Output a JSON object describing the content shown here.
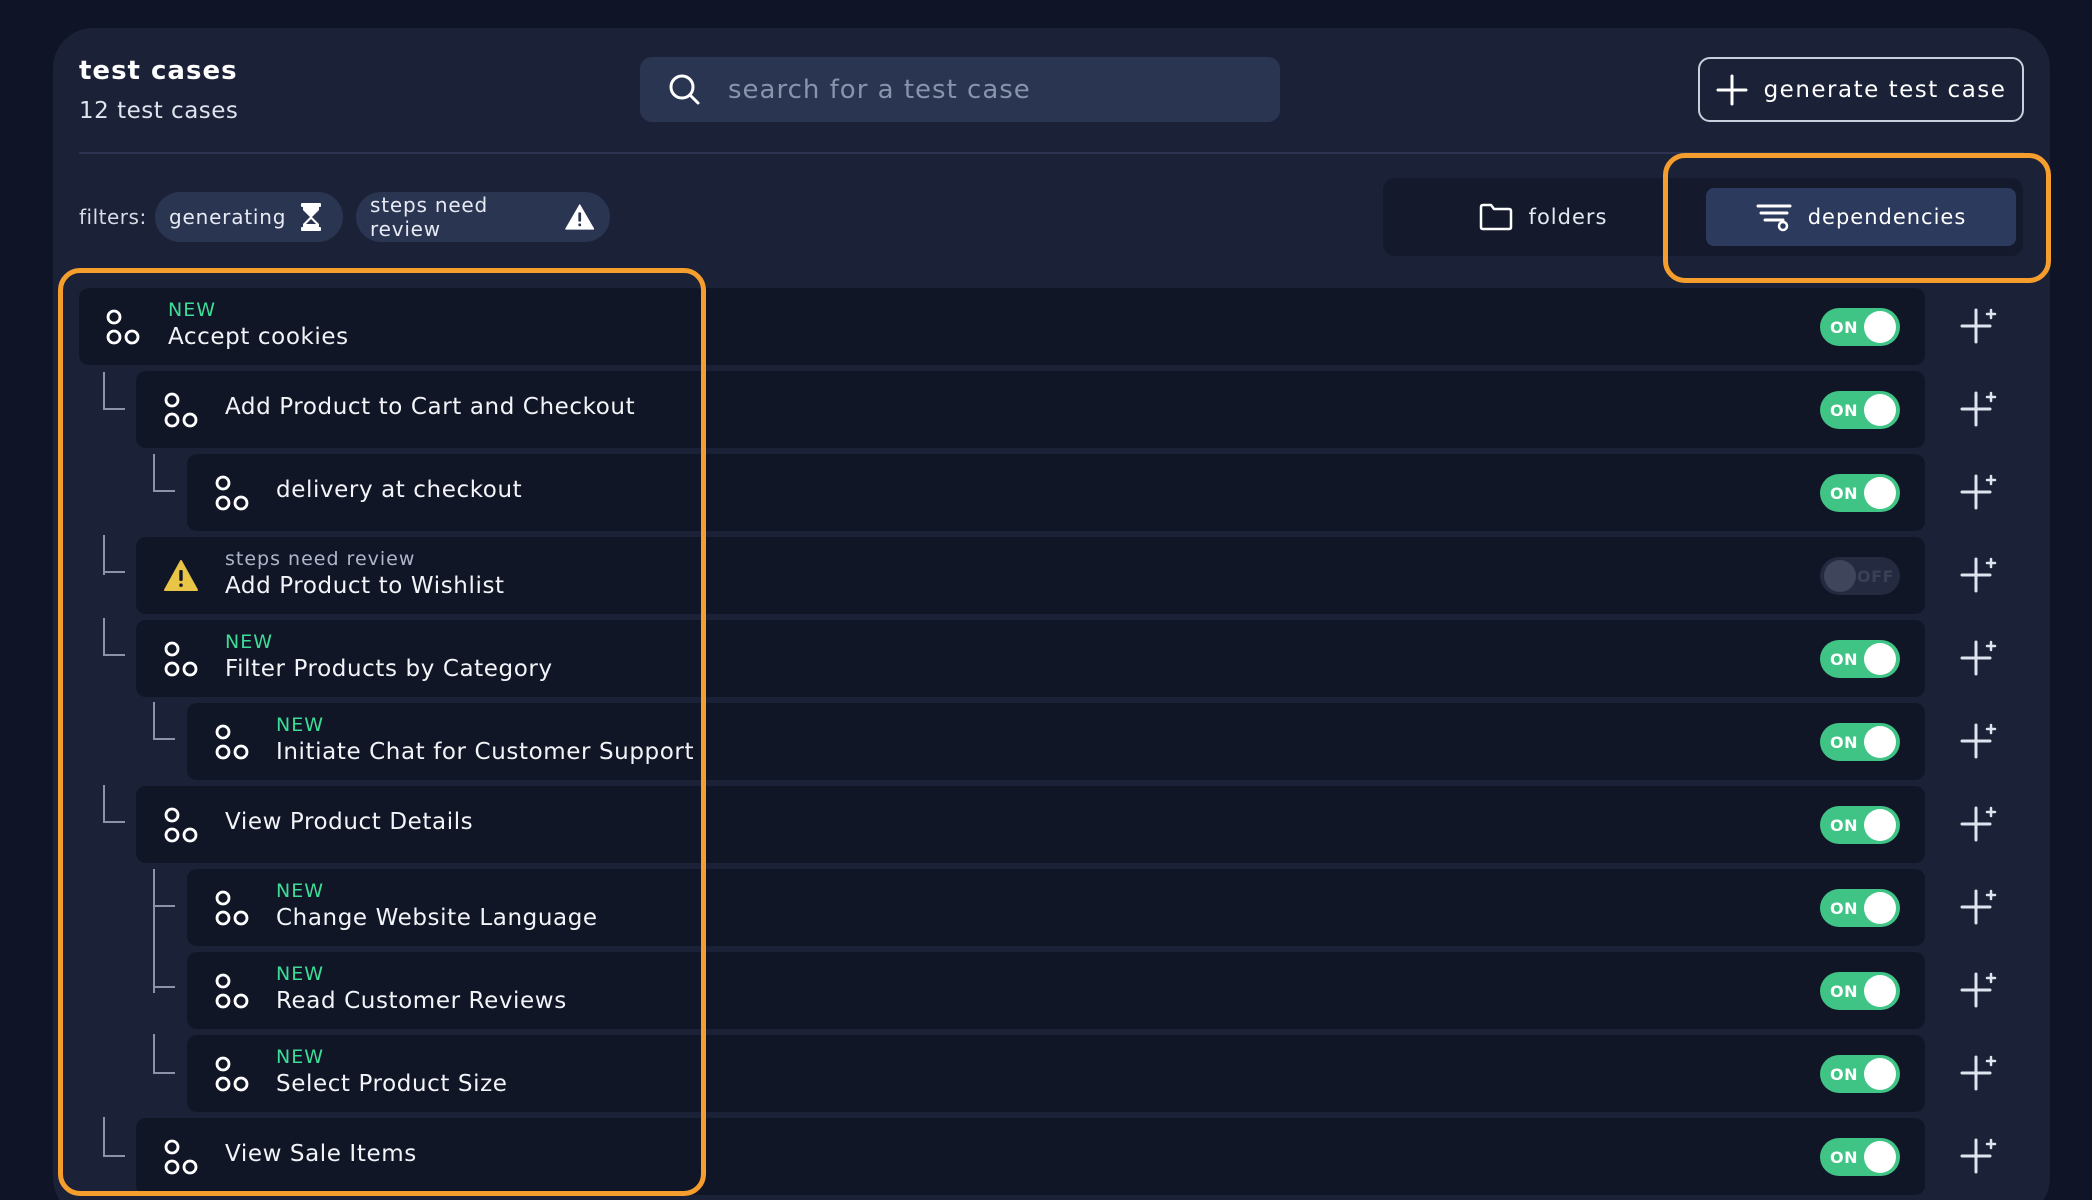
{
  "header": {
    "title": "test cases",
    "count": "12 test cases",
    "search_placeholder": "search for a test case",
    "generate_label": "generate test case"
  },
  "filters": {
    "label": "filters:",
    "chips": [
      {
        "label": "generating",
        "icon": "hourglass-icon"
      },
      {
        "label": "steps need review",
        "icon": "warning-icon"
      }
    ]
  },
  "view_tabs": [
    {
      "label": "folders",
      "icon": "folder-icon",
      "active": false
    },
    {
      "label": "dependencies",
      "icon": "dependencies-icon",
      "active": true
    }
  ],
  "toggle_labels": {
    "on": "ON",
    "off": "OFF"
  },
  "colors": {
    "accent_green": "#3ddc97",
    "toggle_on": "#3fc486",
    "highlight": "#f59e2e",
    "warning": "#e8c547"
  },
  "test_cases": [
    {
      "name": "Accept cookies",
      "status": "NEW",
      "enabled": true,
      "depth": 0
    },
    {
      "name": "Add Product to Cart and Checkout",
      "status": "",
      "enabled": true,
      "depth": 1
    },
    {
      "name": "delivery at checkout",
      "status": "",
      "enabled": true,
      "depth": 2
    },
    {
      "name": "Add Product to Wishlist",
      "status": "steps need review",
      "enabled": false,
      "depth": 1
    },
    {
      "name": "Filter Products by Category",
      "status": "NEW",
      "enabled": true,
      "depth": 1
    },
    {
      "name": "Initiate Chat for Customer Support",
      "status": "NEW",
      "enabled": true,
      "depth": 2
    },
    {
      "name": "View Product Details",
      "status": "",
      "enabled": true,
      "depth": 1
    },
    {
      "name": "Change Website Language",
      "status": "NEW",
      "enabled": true,
      "depth": 2
    },
    {
      "name": "Read Customer Reviews",
      "status": "NEW",
      "enabled": true,
      "depth": 2
    },
    {
      "name": "Select Product Size",
      "status": "NEW",
      "enabled": true,
      "depth": 2
    },
    {
      "name": "View Sale Items",
      "status": "",
      "enabled": true,
      "depth": 1
    }
  ]
}
